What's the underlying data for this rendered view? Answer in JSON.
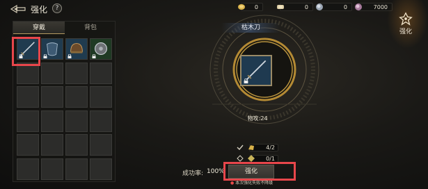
{
  "header": {
    "title": "强化",
    "help_label": "?"
  },
  "currencies": [
    {
      "icon": "gold-coin-icon",
      "value": "0",
      "color": "#d9b24a"
    },
    {
      "icon": "scroll-icon",
      "value": "0",
      "color": "#d8c9a0"
    },
    {
      "icon": "silver-orb-icon",
      "value": "0",
      "color": "#b9c3cf"
    },
    {
      "icon": "purple-gem-icon",
      "value": "7000",
      "color": "#c99bbf"
    }
  ],
  "side_tab": {
    "label": "强化"
  },
  "inventory": {
    "tabs": [
      {
        "label": "穿戴",
        "active": true
      },
      {
        "label": "背包",
        "active": false
      }
    ],
    "rows": 6,
    "cols": 4,
    "items": [
      {
        "icon": "sword-icon",
        "locked": true,
        "selected": true
      },
      {
        "icon": "armor-icon",
        "locked": true,
        "selected": false
      },
      {
        "icon": "helmet-icon",
        "locked": true,
        "selected": false
      },
      {
        "icon": "shield-icon",
        "locked": true,
        "selected": false
      }
    ]
  },
  "enhance": {
    "item_name": "枯木刀",
    "stat": "物攻:24",
    "materials": [
      {
        "icon": "ore-icon",
        "value": "4/2"
      },
      {
        "icon": "gem-icon",
        "value": "0/1"
      }
    ],
    "rate_label": "成功率:",
    "rate_value": "100%",
    "button_label": "强化",
    "note": "本次强化失败不降级"
  },
  "colors": {
    "accent_gold": "#c9a34a",
    "highlight_red": "#e8464b",
    "slot_blue": "#203b4f"
  }
}
